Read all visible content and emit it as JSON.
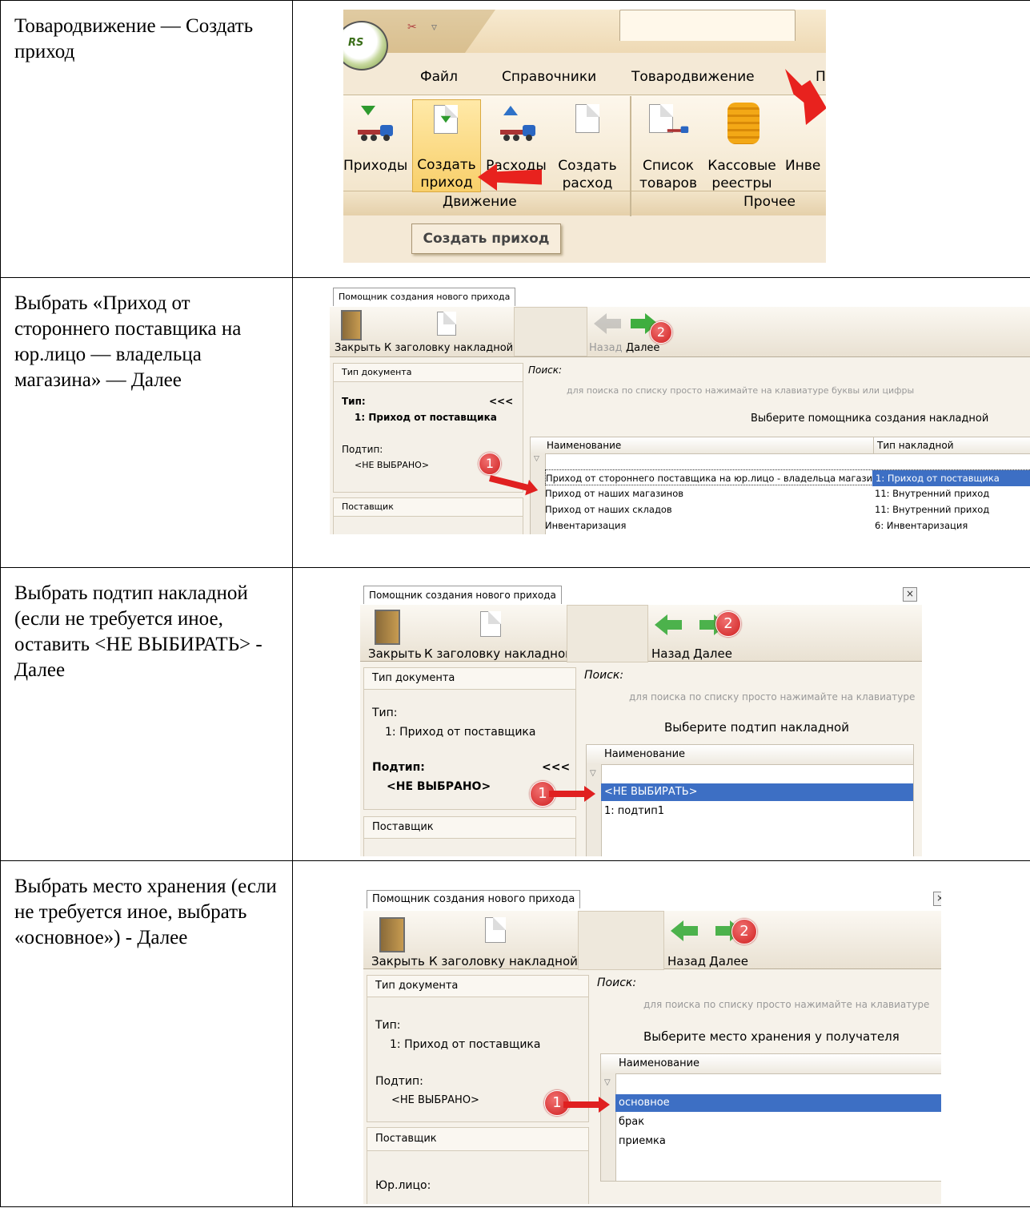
{
  "rows": [
    {
      "text": "Товародвижение — Создать приход"
    },
    {
      "text": "Выбрать «Приход от стороннего поставщика на юр.лицо — владельца магазина» — Далее"
    },
    {
      "text": "Выбрать подтип накладной (если не требуется иное, оставить <НЕ ВЫБИРАТЬ> - Далее"
    },
    {
      "text": "Выбрать место хранения (если не требуется иное, выбрать «основное») - Далее"
    }
  ],
  "ribbon": {
    "tabs": [
      "Файл",
      "Справочники",
      "Товародвижение",
      "П"
    ],
    "buttons": {
      "prihody": "Приходы",
      "sozdat_prihod_1": "Создать",
      "sozdat_prihod_2": "приход",
      "rashody": "Расходы",
      "sozdat_rashod_1": "Создать",
      "sozdat_rashod_2": "расход",
      "spisok_1": "Список",
      "spisok_2": "товаров",
      "kassa_1": "Кассовые",
      "kassa_2": "реестры",
      "inv": "Инве"
    },
    "groups": {
      "dvizhenie": "Движение",
      "prochee": "Прочее"
    },
    "tooltip": "Создать приход",
    "logo_text": "RS"
  },
  "dialog": {
    "tab_title": "Помощник создания нового прихода",
    "close_label": "Закрыть",
    "header_label": "К заголовку накладной",
    "back_label": "Назад",
    "next_label": "Далее",
    "doc_type_header": "Тип документа",
    "type_label": "Тип:",
    "type_value": "1:  Приход от поставщика",
    "subtype_label": "Подтип:",
    "subtype_value": "<НЕ ВЫБРАНО>",
    "marker": "<<<",
    "supplier_header": "Поставщик",
    "legal_label": "Юр.лицо:",
    "search_label": "Поиск:",
    "search_hint_full": "для поиска по списку просто нажимайте на клавиатуре буквы или цифры",
    "search_hint_short": "для поиска по списку просто нажимайте на клавиатуре",
    "col_name": "Наименование",
    "col_invoice_type": "Тип накладной",
    "filter_icon": "filter-icon"
  },
  "step2": {
    "prompt": "Выберите помощника создания накладной",
    "rows": [
      {
        "name": "Приход от стороннего поставщика на юр.лицо - владельца магазина",
        "type": "1:  Приход от поставщика"
      },
      {
        "name": "Приход от наших магазинов",
        "type": "11:  Внутренний приход"
      },
      {
        "name": "Приход от наших складов",
        "type": "11:  Внутренний приход"
      },
      {
        "name": "Инвентаризация",
        "type": "6:  Инвентаризация"
      }
    ]
  },
  "step3": {
    "prompt": "Выберите подтип накладной",
    "rows": [
      "<НЕ ВЫБИРАТЬ>",
      "1: подтип1"
    ]
  },
  "step4": {
    "prompt": "Выберите место хранения у получателя",
    "rows": [
      "основное",
      "брак",
      "приемка"
    ]
  },
  "badges": {
    "one": "1",
    "two": "2"
  },
  "colors": {
    "selection": "#3d6fc4",
    "badge": "#d02020",
    "ribbon_bg": "#f4e9d6"
  }
}
